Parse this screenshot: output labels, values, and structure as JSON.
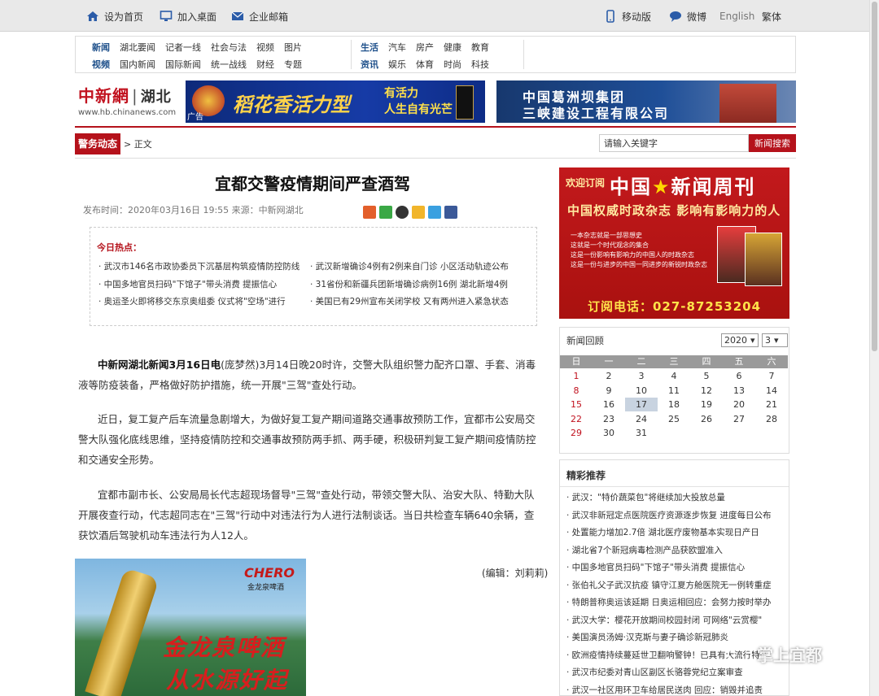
{
  "topbar": {
    "home": "设为首页",
    "desktop": "加入桌面",
    "mail": "企业邮箱",
    "mobile": "移动版",
    "weibo": "微博",
    "english": "English",
    "traditional": "繁体"
  },
  "channels": {
    "row1_left": [
      "新闻",
      "湖北要闻",
      "记者一线",
      "社会与法",
      "视频",
      "图片"
    ],
    "row2_left": [
      "视频",
      "国内新闻",
      "国际新闻",
      "统一战线",
      "财经",
      "专题"
    ],
    "row1_right": [
      "生活",
      "汽车",
      "房产",
      "健康",
      "教育"
    ],
    "row2_right": [
      "资讯",
      "娱乐",
      "体育",
      "时尚",
      "科技"
    ]
  },
  "logo": {
    "cn": "中新網",
    "region": "湖北",
    "url": "www.hb.chinanews.com"
  },
  "ads": {
    "ad1_slogan": "稻花香活力型",
    "ad1_line1": "有活力",
    "ad1_line2": "人生自有光芒",
    "ad1_tag": "广告",
    "ad2_line1": "中国葛洲坝集团",
    "ad2_line2": "三峡建设工程有限公司"
  },
  "breadcrumb": {
    "section": "警务动态",
    "rest": "> 正文"
  },
  "search": {
    "placeholder": "请输入关键字",
    "button": "新闻搜索"
  },
  "article": {
    "title": "宜都交警疫情期间严查酒驾",
    "meta": "发布时间：2020年03月16日 19:55 来源：中新网湖北",
    "hot_title": "今日热点：",
    "hot": [
      "· 武汉市146名市政协委员下沉基层构筑疫情防控防线",
      "· 武汉新增确诊4例有2例来自门诊 小区活动轨迹公布",
      "· 中国多地官员扫码\"下馆子\"带头消费 提振信心",
      "· 31省份和新疆兵团新增确诊病例16例 湖北新增4例",
      "· 奥运圣火即将移交东京奥组委 仪式将\"空场\"进行",
      "· 美国已有29州宣布关闭学校 又有两州进入紧急状态"
    ],
    "p1_lead": "中新网湖北新闻3月16日电",
    "p1_rest": "(庞梦然)3月14日晚20时许，交警大队组织警力配齐口罩、手套、消毒液等防疫装备，严格做好防护措施，统一开展\"三驾\"查处行动。",
    "p2": "近日，复工复产后车流量急剧增大，为做好复工复产期间道路交通事故预防工作，宜都市公安局交警大队强化底线思维，坚持疫情防控和交通事故预防两手抓、两手硬，积极研判复工复产期间疫情防控和交通安全形势。",
    "p3": "宜都市副市长、公安局局长代志超现场督导\"三驾\"查处行动，带领交警大队、治安大队、特勤大队开展夜查行动，代志超同志在\"三驾\"行动中对违法行为人进行法制谈话。当日共检查车辆640余辆，查获饮酒后驾驶机动车违法行为人12人。",
    "editor": "(编辑：刘莉莉)"
  },
  "beer_ad": {
    "brand": "CHERO",
    "brand_sub": "金龙泉啤酒",
    "slogan1": "金龙泉啤酒",
    "slogan2": "从水源好起"
  },
  "magazine_ad": {
    "welcome": "欢迎订阅",
    "name_a": "中国",
    "name_b": "新闻周刊",
    "tagline": "中国权威时政杂志 影响有影响力的人",
    "bullets": [
      "一本杂志就是一部思想史",
      "这就是一个时代观念的集合",
      "这是一份影响有影响力的中国人的时政杂志",
      "这是一份与进步的中国一同进步的新锐时政杂志"
    ],
    "phone": "订阅电话：027-87253204"
  },
  "calendar": {
    "title": "新闻回顾",
    "year": "2020",
    "month": "3",
    "weekdays": [
      "日",
      "一",
      "二",
      "三",
      "四",
      "五",
      "六"
    ],
    "weeks": [
      [
        "1",
        "2",
        "3",
        "4",
        "5",
        "6",
        "7"
      ],
      [
        "8",
        "9",
        "10",
        "11",
        "12",
        "13",
        "14"
      ],
      [
        "15",
        "16",
        "17",
        "18",
        "19",
        "20",
        "21"
      ],
      [
        "22",
        "23",
        "24",
        "25",
        "26",
        "27",
        "28"
      ],
      [
        "29",
        "30",
        "31",
        "",
        "",
        "",
        ""
      ]
    ],
    "today": "17"
  },
  "recommend": {
    "title": "精彩推荐",
    "items": [
      "· 武汉：\"特价蔬菜包\"将继续加大投放总量",
      "· 武汉非新冠定点医院医疗资源逐步恢复 进度每日公布",
      "· 处置能力增加2.7倍 湖北医疗废物基本实现日产日",
      "· 湖北省7个新冠病毒检测产品获欧盟准入",
      "· 中国多地官员扫码\"下馆子\"带头消费 提振信心",
      "· 张伯礼父子武汉抗疫 镇守江夏方舱医院无一例转重症",
      "· 特朗普称奥运该延期 日奥运相回应：会努力按时举办",
      "· 武汉大学：樱花开放期间校园封闭 可网络\"云赏樱\"",
      "· 美国演员汤姆·汉克斯与妻子确诊新冠肺炎",
      "· 欧洲疫情持续蔓延世卫翻响警钟！已具有大流行特征",
      "· 武汉市纪委对青山区副区长骆蓉党纪立案审查",
      "· 武汉一社区用环卫车给居民送肉 回应：销毁并追责"
    ]
  },
  "watermark": "掌上宜都"
}
